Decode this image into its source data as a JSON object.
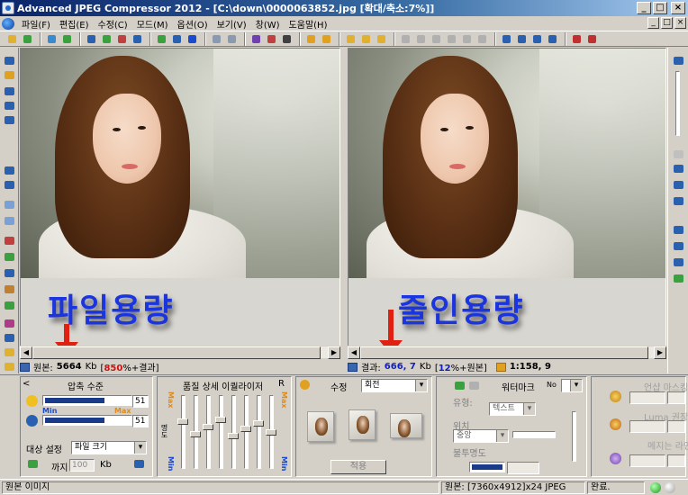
{
  "window": {
    "title": "Advanced JPEG Compressor 2012 - [C:\\down\\0000063852.jpg [확대/축소:7%]]",
    "minimize_label": "_",
    "maximize_label": "□",
    "close_label": "×"
  },
  "menu": {
    "items": [
      "파일(F)",
      "편집(E)",
      "수정(C)",
      "모드(M)",
      "옵션(O)",
      "보기(V)",
      "창(W)",
      "도움말(H)"
    ],
    "mdi_controls": [
      "_",
      "□",
      "×"
    ]
  },
  "panes": {
    "left_caption": "파일용량",
    "right_caption": "줄인용량"
  },
  "info_left": {
    "prefix": "원본:",
    "size_value": "5664",
    "size_unit": "Kb",
    "ratio_open": "[",
    "ratio": "850",
    "ratio_suffix": "%+결과]"
  },
  "info_right": {
    "prefix": "결과:",
    "size_value": "666, 7",
    "size_unit": "Kb",
    "ratio_open": "[",
    "ratio": "12",
    "ratio_suffix": "%+원본]",
    "compression_ratio": "1:158, 9"
  },
  "compression": {
    "title": "압축 수준",
    "back_label": "<",
    "min_label": "Min",
    "max_label": "Max",
    "value_1": "51",
    "value_2": "51",
    "target_label": "대상 설정",
    "target_value": "파일 크기",
    "until_label": "까지",
    "until_value": "100",
    "until_unit": "Kb"
  },
  "equalizer": {
    "title": "품질 상세 이퀄라이저",
    "r_label": "R",
    "max_label": "Max",
    "min_label": "Min",
    "side_label": "명도"
  },
  "correction": {
    "title": "수정",
    "mode_value": "회전",
    "apply_label": "적용"
  },
  "watermark": {
    "title": "워터마크",
    "no_label": "No",
    "type_label": "유형:",
    "type_value": "텍스트",
    "position_label": "위치",
    "position_value": "중앙",
    "opacity_label": "불투명도"
  },
  "unsharp": {
    "title": "언샵 마스킹",
    "luma_label": "Luma 권장",
    "sharpen_label": "메지는 라인"
  },
  "status": {
    "left_text": "원본 이미지",
    "info_text": "원본: [7360x4912]x24 JPEG",
    "done_text": "완료."
  },
  "colors": {
    "title_bar": "#0a246a",
    "caption_text": "#1a35e0",
    "arrow": "#e02010",
    "ratio_red": "#d01010",
    "ratio_blue": "#1020c0",
    "led_green": "#2cc82c"
  },
  "icons": {
    "app": "jpeg-compressor-icon",
    "menu": "globe-icon",
    "arrow": "red-down-arrow-icon",
    "led": "status-led-icon"
  }
}
